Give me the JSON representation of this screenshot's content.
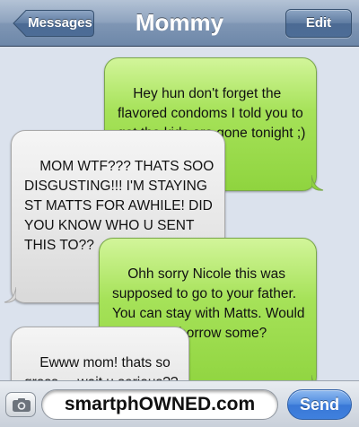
{
  "nav": {
    "back_label": "Messages",
    "title": "Mommy",
    "edit_label": "Edit"
  },
  "messages": [
    {
      "from": "me",
      "text": "Hey hun don't forget the\nflavored condoms I told you to\nget the kids are gone tonight ;)"
    },
    {
      "from": "contact",
      "text": "MOM WTF??? THATS SOO\nDISGUSTING!!! I'M STAYING\nST MATTS FOR AWHILE! DID\nYOU KNOW WHO U SENT\nTHIS TO??"
    },
    {
      "from": "me",
      "text": "Ohh sorry Nicole this was\nsupposed to go to your father.\nYou can stay with Matts. Would\nyou like to borrow some?"
    },
    {
      "from": "contact",
      "text": "Ewww mom! thats so\ngross.....wait u serious??"
    }
  ],
  "composer": {
    "camera_icon": "camera-icon",
    "field_value": "smartphOWNED.com",
    "send_label": "Send"
  },
  "colors": {
    "sent_bubble": "#a6e259",
    "received_bubble": "#e8e8e8",
    "thread_background": "#dbe2ed",
    "send_button": "#3a78d6"
  }
}
